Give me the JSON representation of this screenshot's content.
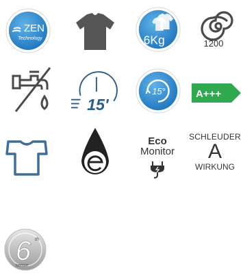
{
  "icons": {
    "zen": {
      "name": "ZEN",
      "sub": "Technology"
    },
    "tshirt": {
      "icon": "tshirt-icon"
    },
    "capacity": {
      "value": "6Kg",
      "icon": "laundry-load-icon"
    },
    "spin": {
      "value": "1200",
      "icon": "spin-spiral-icon"
    },
    "water": {
      "icon": "faucet-no-water-icon"
    },
    "quick": {
      "value": "15'",
      "icon": "quick-wash-icon"
    },
    "temp": {
      "value": "15°",
      "icon": "low-temp-icon"
    },
    "energy": {
      "value": "A+++",
      "color": "#2fa84f"
    },
    "shirt_outline": {
      "icon": "shirt-outline-icon"
    },
    "drop": {
      "icon": "eco-drop-icon"
    },
    "eco_monitor": {
      "line1": "Eco",
      "line2": "Monitor",
      "icon": "plug-icon"
    },
    "schleuder": {
      "line1": "SCHLEUDER",
      "grade": "A",
      "line2": "WIRKUNG"
    },
    "sixth_sense": {
      "six": "6",
      "th": "th",
      "sense": "sense",
      "icon": "6th-sense-logo"
    }
  },
  "colors": {
    "blue": "#3a8fd0",
    "blue_dark": "#2b78b8",
    "gray": "#5a5a5a",
    "shirt_blue": "#3f6f99"
  }
}
